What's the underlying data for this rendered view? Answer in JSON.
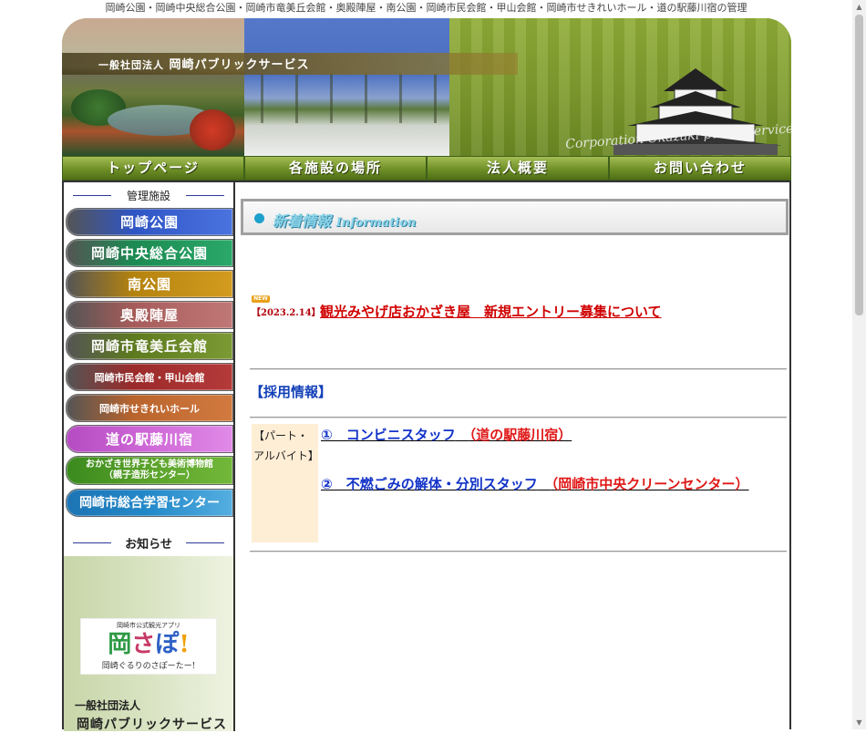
{
  "top_line": "岡崎公園・岡崎中央総合公園・岡崎市竜美丘会館・奥殿陣屋・南公園・岡崎市民会館・甲山会館・岡崎市せきれいホール・道の駅藤川宿の管理",
  "header": {
    "org_prefix": "一般社団法人",
    "org_name": "岡崎パブリックサービス",
    "copyright_script": "Corporation Okazaki public service"
  },
  "nav": [
    "トップページ",
    "各施設の場所",
    "法人概要",
    "お問い合わせ"
  ],
  "sidebar": {
    "section_title": "管理施設",
    "facilities": [
      {
        "label": "岡崎公園",
        "color": "#2f55c4"
      },
      {
        "label": "岡崎中央総合公園",
        "color": "#1c8a52"
      },
      {
        "label": "南公園",
        "color": "#b4830f"
      },
      {
        "label": "奥殿陣屋",
        "color": "#a65c5a"
      },
      {
        "label": "岡崎市竜美丘会館",
        "color": "#6a8a24"
      },
      {
        "label": "岡崎市民会館・甲山会館",
        "color": "#9b2a2a"
      },
      {
        "label": "岡崎市せきれいホール",
        "color": "#b9642d"
      },
      {
        "label": "道の駅藤川宿",
        "color": "#cf68d7"
      },
      {
        "label": "おかざき世界子ども美術博物館",
        "label2": "（親子造形センター）",
        "color": "#5aa22a"
      },
      {
        "label": "岡崎市総合学習センター",
        "color": "#2389c9"
      }
    ],
    "notice_title": "お知らせ",
    "app": {
      "caption": "岡崎市公式観光アプリ",
      "logo_a": "岡",
      "logo_b": "さ",
      "logo_c": "ぽ",
      "logo_d": "!",
      "subtitle": "岡崎ぐるりのさぽーたー!"
    },
    "corp_line1": "一般社団法人",
    "corp_line2": "岡崎パブリックサービス"
  },
  "main": {
    "section_title": "新着情報",
    "section_title_en": "Information",
    "news": [
      {
        "badge": "NEW",
        "date": "【2023.2.14】",
        "title": "観光みやげ店おかざき屋　新規エントリー募集について"
      }
    ],
    "recruit_title": "【採用情報】",
    "job_category": "【パート・アルバイト】",
    "jobs": [
      {
        "num_title": "①　コンビニスタッフ",
        "place": "（道の駅藤川宿）"
      },
      {
        "num_title": "②　不燃ごみの解体・分別スタッフ",
        "place": "（岡崎市中央クリーンセンター）"
      }
    ]
  }
}
